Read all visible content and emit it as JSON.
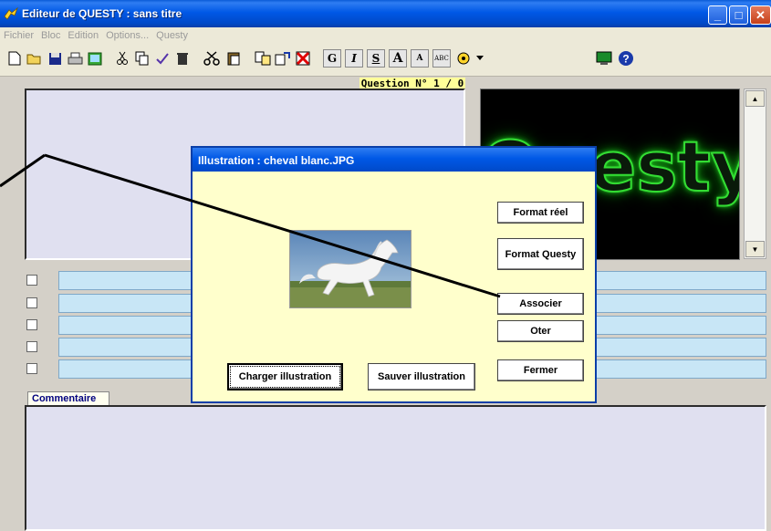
{
  "window": {
    "title": "Editeur de QUESTY : sans titre",
    "minimize_glyph": "_",
    "maximize_glyph": "□",
    "close_glyph": "✕"
  },
  "menu": [
    "Fichier",
    "Bloc",
    "Edition",
    "Options...",
    "Questy"
  ],
  "toolbar": {
    "format_buttons": [
      "G",
      "I",
      "S",
      "A",
      "A",
      "ABC"
    ]
  },
  "editor": {
    "question_label": "Question N° 1 / 0",
    "logo_text": "Questy",
    "comment_tab": "Commentaire",
    "answer_rows": 5
  },
  "dialog": {
    "title": "Illustration : cheval blanc.JPG",
    "buttons": {
      "format_reel": "Format réel",
      "format_questy": "Format Questy",
      "associer": "Associer",
      "oter": "Oter",
      "fermer": "Fermer",
      "charger": "Charger illustration",
      "sauver": "Sauver illustration"
    }
  },
  "colors": {
    "titlebar": "#0058e6",
    "dialog_bg": "#ffffcc",
    "answer_field": "#c8e6f6",
    "logo_glow": "#33dd33"
  }
}
